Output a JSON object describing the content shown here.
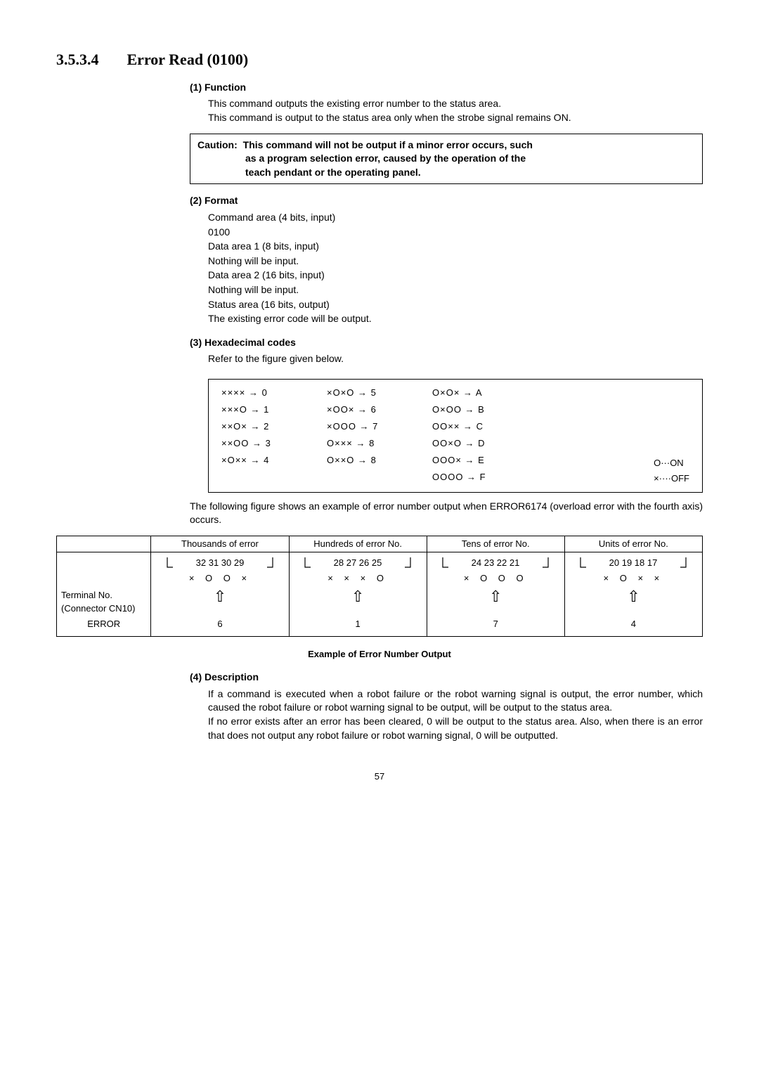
{
  "section": {
    "number": "3.5.3.4",
    "title": "Error Read (0100)"
  },
  "h1": "(1) Function",
  "p1a": "This command outputs the existing error number to the status area.",
  "p1b": "This command is output to the status area only when the strobe signal remains ON.",
  "caution": {
    "label": "Caution:",
    "l1": "This command will not be output if a minor error occurs, such",
    "l2": "as a program selection error, caused by the operation of the",
    "l3": "teach pendant or the operating panel."
  },
  "h2": "(2) Format",
  "fmt": [
    "Command area (4 bits, input)",
    "0100",
    "Data area 1 (8 bits, input)",
    "Nothing will be input.",
    "Data area 2 (16 bits, input)",
    "Nothing will be input.",
    "Status area (16 bits, output)",
    "The existing error code will be output."
  ],
  "h3": "(3) Hexadecimal codes",
  "p3": "Refer to the figure given below.",
  "hex": {
    "c1": [
      "××××    → 0",
      "×××O   → 1",
      "××O×   → 2",
      "××OO  → 3",
      "×O××   → 4"
    ],
    "c2": [
      "×O×O  → 5",
      "×OO×  → 6",
      "×OOO → 7",
      "O×××   → 8",
      "O××O  → 8"
    ],
    "c3": [
      "O×O×  → A",
      "O×OO → B",
      "OO××  → C",
      "OO×O → D",
      "OOO× → E",
      "OOOO → F"
    ],
    "legend": [
      "O···ON",
      "×····OFF"
    ]
  },
  "example_intro": "The following figure shows an example of error number output when ERROR6174 (overload error with the fourth axis) occurs.",
  "ex": {
    "cols": [
      "Thousands   of   error",
      "Hundreds of error No.",
      "Tens of error No.",
      "Units of error No."
    ],
    "bits": [
      "32 31 30 29",
      "28 27 26 25",
      "24 23 22 21",
      "20 19 18 17"
    ],
    "pat": [
      "× O O ×",
      "× × × O",
      "× O O O",
      "× O × ×"
    ],
    "side1": "Terminal No.",
    "side2": "(Connector CN10)",
    "side3": "ERROR",
    "vals": [
      "6",
      "1",
      "7",
      "4"
    ]
  },
  "caption": "Example of Error Number Output",
  "h4": "(4) Description",
  "p4a": "If a command is executed when a robot failure or the robot warning signal is output, the error number, which caused the robot failure or robot warning signal to be output, will be output to the status area.",
  "p4b": "If no error exists after an error has been cleared, 0 will be output to the status area. Also, when there is an error that does not output any robot failure or robot warning signal, 0 will be outputted.",
  "page": "57"
}
